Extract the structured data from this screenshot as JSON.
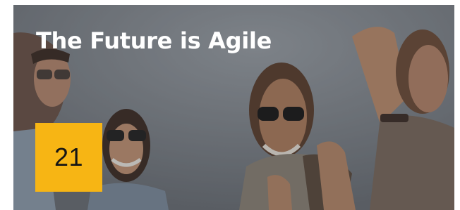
{
  "card": {
    "title": "The Future is Agile",
    "badge_number": "21",
    "badge_color": "#f7b514",
    "image": "people-celebrating-photo"
  }
}
